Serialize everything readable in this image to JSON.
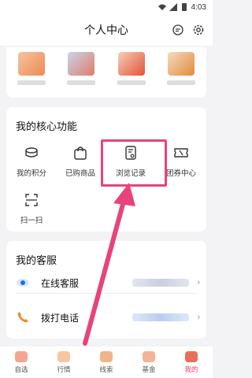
{
  "status": {
    "time": "4:03"
  },
  "header": {
    "title": "个人中心"
  },
  "core": {
    "title": "我的核心功能",
    "items": [
      {
        "label": "我的积分"
      },
      {
        "label": "已购商品"
      },
      {
        "label": "浏览记录"
      },
      {
        "label": "团券中心"
      },
      {
        "label": "扫一扫"
      }
    ]
  },
  "service": {
    "title": "我的客服",
    "items": [
      {
        "label": "在线客服"
      },
      {
        "label": "拨打电话"
      }
    ]
  },
  "nav": {
    "items": [
      {
        "label": "自选"
      },
      {
        "label": "行情"
      },
      {
        "label": "线索"
      },
      {
        "label": "基金"
      },
      {
        "label": "我的"
      }
    ]
  },
  "colors": {
    "accent": "#e8437a",
    "blue": "#1e6fe0",
    "orange": "#f08a2c"
  }
}
